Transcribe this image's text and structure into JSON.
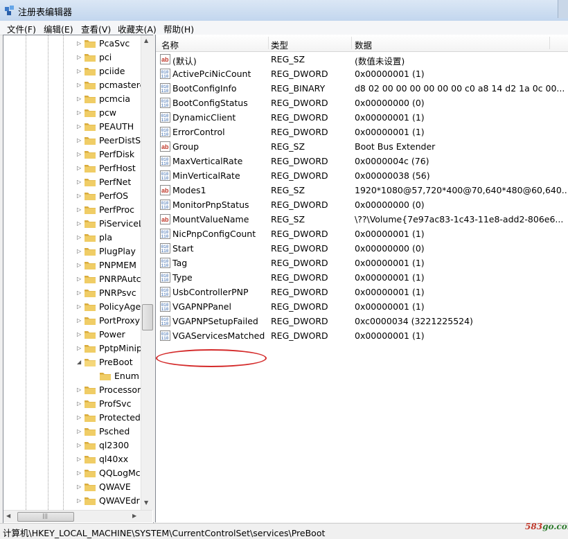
{
  "window": {
    "title": "注册表编辑器"
  },
  "menu": [
    "文件(F)",
    "编辑(E)",
    "查看(V)",
    "收藏夹(A)",
    "帮助(H)"
  ],
  "tree": {
    "items": [
      {
        "label": "PcaSvc",
        "expandable": true
      },
      {
        "label": "pci",
        "expandable": true
      },
      {
        "label": "pciide",
        "expandable": true
      },
      {
        "label": "pcmastere",
        "expandable": true
      },
      {
        "label": "pcmcia",
        "expandable": true
      },
      {
        "label": "pcw",
        "expandable": true
      },
      {
        "label": "PEAUTH",
        "expandable": true
      },
      {
        "label": "PeerDistSv",
        "expandable": true
      },
      {
        "label": "PerfDisk",
        "expandable": true
      },
      {
        "label": "PerfHost",
        "expandable": true
      },
      {
        "label": "PerfNet",
        "expandable": true
      },
      {
        "label": "PerfOS",
        "expandable": true
      },
      {
        "label": "PerfProc",
        "expandable": true
      },
      {
        "label": "PiServiceL",
        "expandable": true
      },
      {
        "label": "pla",
        "expandable": true
      },
      {
        "label": "PlugPlay",
        "expandable": true
      },
      {
        "label": "PNPMEM",
        "expandable": true
      },
      {
        "label": "PNRPAutc",
        "expandable": true
      },
      {
        "label": "PNRPsvc",
        "expandable": true
      },
      {
        "label": "PolicyAge",
        "expandable": true
      },
      {
        "label": "PortProxy",
        "expandable": true
      },
      {
        "label": "Power",
        "expandable": true
      },
      {
        "label": "PptpMinip",
        "expandable": true
      },
      {
        "label": "PreBoot",
        "expandable": true,
        "expanded": true,
        "selected": true
      },
      {
        "label": "Enum",
        "expandable": false,
        "child": true
      },
      {
        "label": "Processor",
        "expandable": true
      },
      {
        "label": "ProfSvc",
        "expandable": true
      },
      {
        "label": "Protected",
        "expandable": true
      },
      {
        "label": "Psched",
        "expandable": true
      },
      {
        "label": "ql2300",
        "expandable": true
      },
      {
        "label": "ql40xx",
        "expandable": true
      },
      {
        "label": "QQLogMc",
        "expandable": true
      },
      {
        "label": "QWAVE",
        "expandable": true
      },
      {
        "label": "QWAVEdr",
        "expandable": true
      }
    ]
  },
  "columns": {
    "name": "名称",
    "type": "类型",
    "data": "数据"
  },
  "values": [
    {
      "name": "(默认)",
      "type": "REG_SZ",
      "data": "(数值未设置)",
      "icon": "string"
    },
    {
      "name": "ActivePciNicCount",
      "type": "REG_DWORD",
      "data": "0x00000001 (1)",
      "icon": "binary"
    },
    {
      "name": "BootConfigInfo",
      "type": "REG_BINARY",
      "data": "d8 02 00 00 00 00 00 00 c0 a8 14 d2 1a 0c 00...",
      "icon": "binary"
    },
    {
      "name": "BootConfigStatus",
      "type": "REG_DWORD",
      "data": "0x00000000 (0)",
      "icon": "binary"
    },
    {
      "name": "DynamicClient",
      "type": "REG_DWORD",
      "data": "0x00000001 (1)",
      "icon": "binary"
    },
    {
      "name": "ErrorControl",
      "type": "REG_DWORD",
      "data": "0x00000001 (1)",
      "icon": "binary"
    },
    {
      "name": "Group",
      "type": "REG_SZ",
      "data": "Boot Bus Extender",
      "icon": "string"
    },
    {
      "name": "MaxVerticalRate",
      "type": "REG_DWORD",
      "data": "0x0000004c (76)",
      "icon": "binary"
    },
    {
      "name": "MinVerticalRate",
      "type": "REG_DWORD",
      "data": "0x00000038 (56)",
      "icon": "binary"
    },
    {
      "name": "Modes1",
      "type": "REG_SZ",
      "data": "1920*1080@57,720*400@70,640*480@60,640...",
      "icon": "string"
    },
    {
      "name": "MonitorPnpStatus",
      "type": "REG_DWORD",
      "data": "0x00000000 (0)",
      "icon": "binary"
    },
    {
      "name": "MountValueName",
      "type": "REG_SZ",
      "data": "\\??\\Volume{7e97ac83-1c43-11e8-add2-806e6...",
      "icon": "string"
    },
    {
      "name": "NicPnpConfigCount",
      "type": "REG_DWORD",
      "data": "0x00000001 (1)",
      "icon": "binary"
    },
    {
      "name": "Start",
      "type": "REG_DWORD",
      "data": "0x00000000 (0)",
      "icon": "binary"
    },
    {
      "name": "Tag",
      "type": "REG_DWORD",
      "data": "0x00000001 (1)",
      "icon": "binary"
    },
    {
      "name": "Type",
      "type": "REG_DWORD",
      "data": "0x00000001 (1)",
      "icon": "binary"
    },
    {
      "name": "UsbControllerPNP",
      "type": "REG_DWORD",
      "data": "0x00000001 (1)",
      "icon": "binary"
    },
    {
      "name": "VGAPNPPanel",
      "type": "REG_DWORD",
      "data": "0x00000001 (1)",
      "icon": "binary"
    },
    {
      "name": "VGAPNPSetupFailed",
      "type": "REG_DWORD",
      "data": "0xc0000034 (3221225524)",
      "icon": "binary",
      "highlighted": true
    },
    {
      "name": "VGAServicesMatched",
      "type": "REG_DWORD",
      "data": "0x00000001 (1)",
      "icon": "binary"
    }
  ],
  "status": {
    "path": "计算机\\HKEY_LOCAL_MACHINE\\SYSTEM\\CurrentControlSet\\services\\PreBoot",
    "watermark_a": "583",
    "watermark_b": "go.com"
  },
  "colors": {
    "highlight": "#d42a2a",
    "folder": "#e8c15a",
    "accent": "#2a5ea8"
  }
}
